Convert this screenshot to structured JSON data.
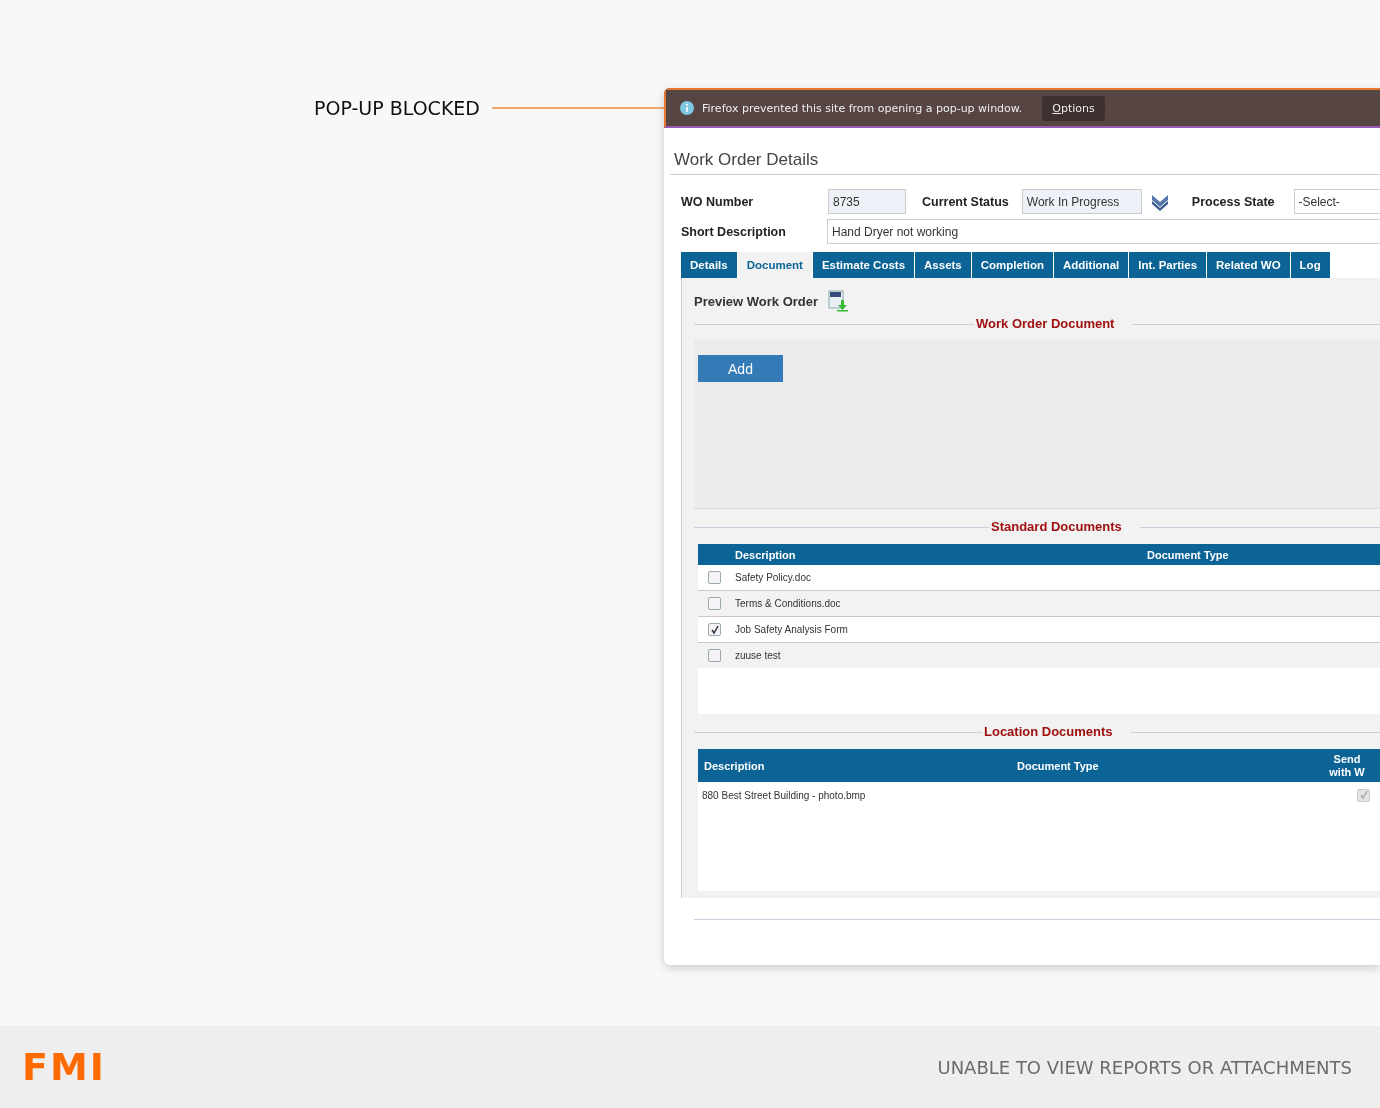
{
  "callout": {
    "label": "POP-UP BLOCKED"
  },
  "notification": {
    "message": "Firefox prevented this site from opening a pop-up window.",
    "button": "Options"
  },
  "form": {
    "title": "Work Order Details",
    "wo_number": {
      "label": "WO Number",
      "value": "8735"
    },
    "current_status": {
      "label": "Current Status",
      "value": "Work In Progress"
    },
    "process_state": {
      "label": "Process State",
      "value": "-Select-"
    },
    "short_description": {
      "label": "Short Description",
      "value": "Hand Dryer not working"
    }
  },
  "tabs": [
    {
      "label": "Details",
      "selected": false
    },
    {
      "label": "Document",
      "selected": true
    },
    {
      "label": "Estimate Costs",
      "selected": false
    },
    {
      "label": "Assets",
      "selected": false
    },
    {
      "label": "Completion",
      "selected": false
    },
    {
      "label": "Additional",
      "selected": false
    },
    {
      "label": "Int. Parties",
      "selected": false
    },
    {
      "label": "Related WO",
      "selected": false
    },
    {
      "label": "Log",
      "selected": false
    }
  ],
  "preview": {
    "label": "Preview Work Order"
  },
  "work_order_document": {
    "title": "Work Order Document",
    "button": "Add"
  },
  "standard_documents": {
    "title": "Standard Documents",
    "columns": [
      "Description",
      "Document Type"
    ],
    "rows": [
      {
        "description": "Safety Policy.doc",
        "checked": false
      },
      {
        "description": "Terms & Conditions.doc",
        "checked": false
      },
      {
        "description": "Job Safety Analysis Form",
        "checked": true
      },
      {
        "description": "zuuse test",
        "checked": false
      }
    ]
  },
  "location_documents": {
    "title": "Location Documents",
    "columns": [
      "Description",
      "Document Type",
      "Send with W"
    ],
    "rows": [
      {
        "description": "880 Best Street Building - photo.bmp",
        "checked": true,
        "disabled": true
      }
    ]
  },
  "footer": {
    "logo": "FMI",
    "caption": "UNABLE TO VIEW REPORTS OR ATTACHMENTS"
  }
}
